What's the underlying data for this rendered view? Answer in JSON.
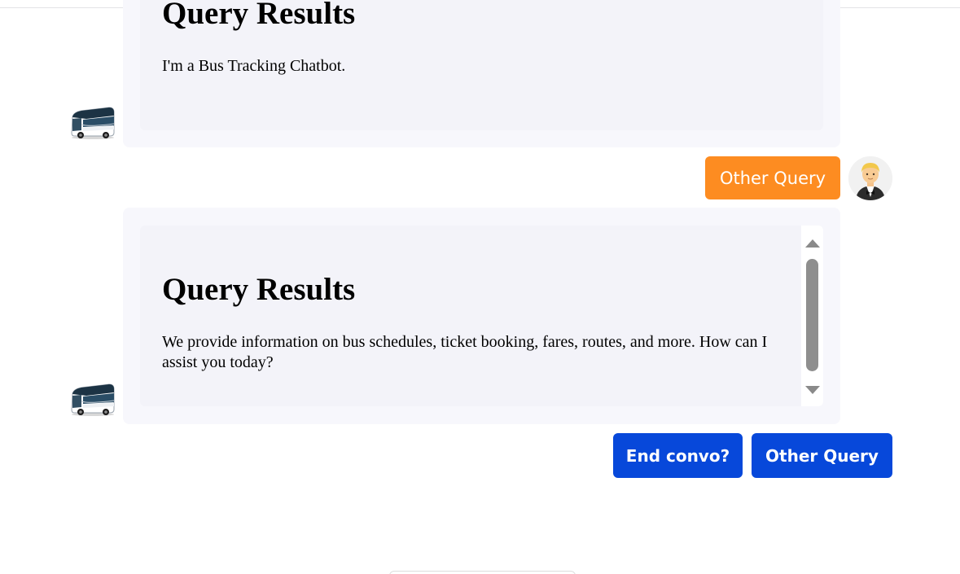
{
  "messages": [
    {
      "sender": "bot",
      "avatar_icon": "bus-icon",
      "title": "Query Results",
      "text": "I'm a Bus Tracking Chatbot."
    },
    {
      "sender": "user",
      "avatar_icon": "man-in-tuxedo-emoji",
      "text": "Other Query"
    },
    {
      "sender": "bot",
      "avatar_icon": "bus-icon",
      "title": "Query Results",
      "text": " We provide information on bus schedules, ticket booking, fares, routes, and more. How can I assist you today?"
    }
  ],
  "actions": {
    "end_label": "End convo?",
    "other_label": "Other Query"
  },
  "colors": {
    "user_bubble": "#fd8c21",
    "action_button": "#0748da",
    "bot_bubble": "#f7f7fc"
  }
}
